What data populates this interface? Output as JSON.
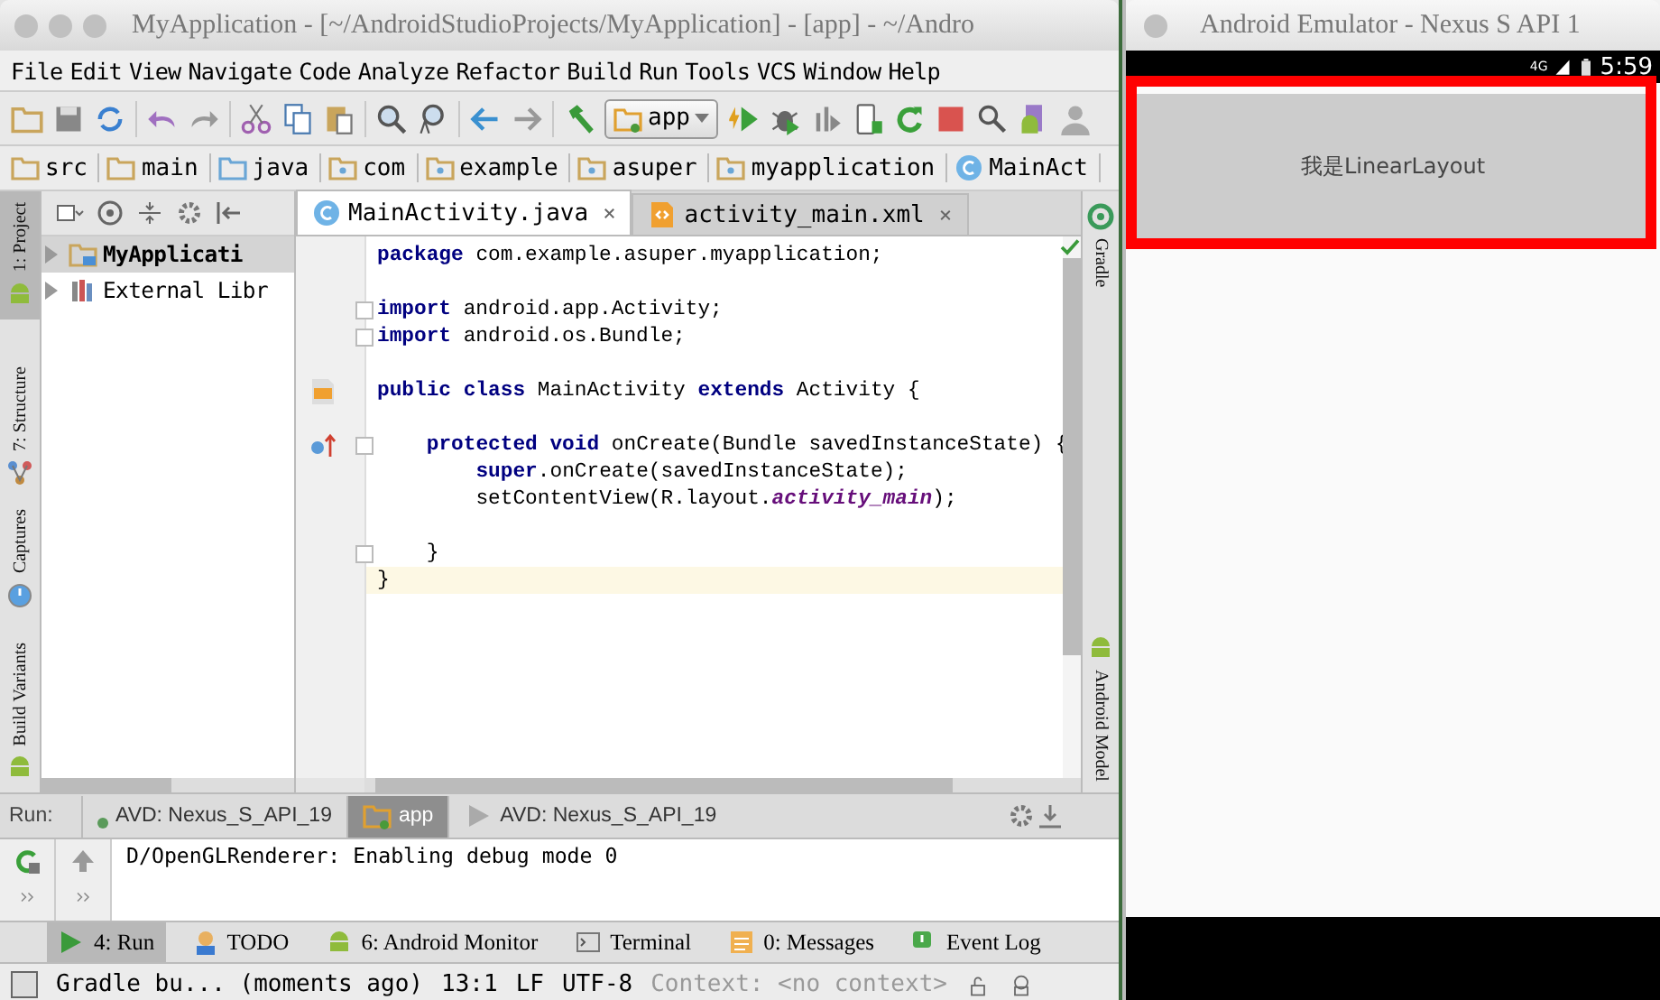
{
  "ide": {
    "title": "MyApplication - [~/AndroidStudioProjects/MyApplication] - [app] - ~/Andro",
    "menu": [
      "File",
      "Edit",
      "View",
      "Navigate",
      "Code",
      "Analyze",
      "Refactor",
      "Build",
      "Run",
      "Tools",
      "VCS",
      "Window",
      "Help"
    ],
    "run_config": "app",
    "breadcrumbs": [
      {
        "label": "src",
        "kind": "folder"
      },
      {
        "label": "main",
        "kind": "folder"
      },
      {
        "label": "java",
        "kind": "source"
      },
      {
        "label": "com",
        "kind": "package"
      },
      {
        "label": "example",
        "kind": "package"
      },
      {
        "label": "asuper",
        "kind": "package"
      },
      {
        "label": "myapplication",
        "kind": "package"
      },
      {
        "label": "MainAct",
        "kind": "class"
      }
    ],
    "left_strip": [
      {
        "label": "1: Project",
        "kind": "android",
        "selected": true
      },
      {
        "label": "7: Structure",
        "kind": "structure",
        "selected": false
      },
      {
        "label": "Captures",
        "kind": "captures",
        "selected": false
      },
      {
        "label": "Build Variants",
        "kind": "android",
        "selected": false
      }
    ],
    "project_tree": [
      {
        "label": "MyApplicati",
        "kind": "module",
        "selected": true
      },
      {
        "label": "External Libr",
        "kind": "library",
        "selected": false
      }
    ],
    "editor_tabs": [
      {
        "label": "MainActivity.java",
        "kind": "class",
        "selected": true,
        "close": "×"
      },
      {
        "label": "activity_main.xml",
        "kind": "xml",
        "selected": false,
        "close": "×"
      }
    ],
    "code_blocks": [
      [
        {
          "text": "**package** com.example.asuper.myapplication;"
        }
      ],
      [
        {
          "text": "**import** android.app.Activity;",
          "fold": true
        },
        {
          "text": "**import** android.os.Bundle;",
          "fold": true
        }
      ],
      [
        {
          "text": "**public class** MainActivity **extends** Activity {",
          "layout_marker": true
        }
      ],
      [
        {
          "text": "    **protected void** onCreate(Bundle savedInstanceState) {",
          "override_marker": true,
          "fold": true
        },
        {
          "text": "        **super**.onCreate(savedInstanceState);"
        },
        {
          "text": "        setContentView(R.layout.*activity_main*);"
        }
      ],
      [
        {
          "text": "    }",
          "fold": true
        },
        {
          "text": "}",
          "current": true
        }
      ]
    ],
    "right_strip": [
      {
        "label": "Gradle",
        "kind": "gradle"
      },
      {
        "label": "Android Model",
        "kind": "android"
      }
    ],
    "run_panel": {
      "label": "Run:",
      "tabs": [
        {
          "label": "AVD: Nexus_S_API_19",
          "kind": "device",
          "selected": false
        },
        {
          "label": "app",
          "kind": "app",
          "selected": true
        },
        {
          "label": "AVD: Nexus_S_API_19",
          "kind": "play",
          "selected": false
        }
      ],
      "console": [
        "D/OpenGLRenderer: Enabling debug mode 0"
      ]
    },
    "tool_tabs": [
      {
        "label": "4: Run",
        "kind": "run",
        "selected": true
      },
      {
        "label": "TODO",
        "kind": "todo",
        "selected": false
      },
      {
        "label": "6: Android Monitor",
        "kind": "android",
        "selected": false
      },
      {
        "label": "Terminal",
        "kind": "terminal",
        "selected": false
      },
      {
        "label": "0: Messages",
        "kind": "messages",
        "selected": false
      },
      {
        "label": "Event Log",
        "kind": "log",
        "selected": false
      }
    ],
    "status_bar": {
      "message": "Gradle bu... (moments ago)",
      "position": "13:1",
      "line_separator": "LF",
      "encoding": "UTF-8",
      "context": "Context: <no context>"
    }
  },
  "emulator": {
    "title": "Android Emulator - Nexus S API 1",
    "network": "4G",
    "clock": "5:59",
    "layout_text": "我是LinearLayout"
  }
}
